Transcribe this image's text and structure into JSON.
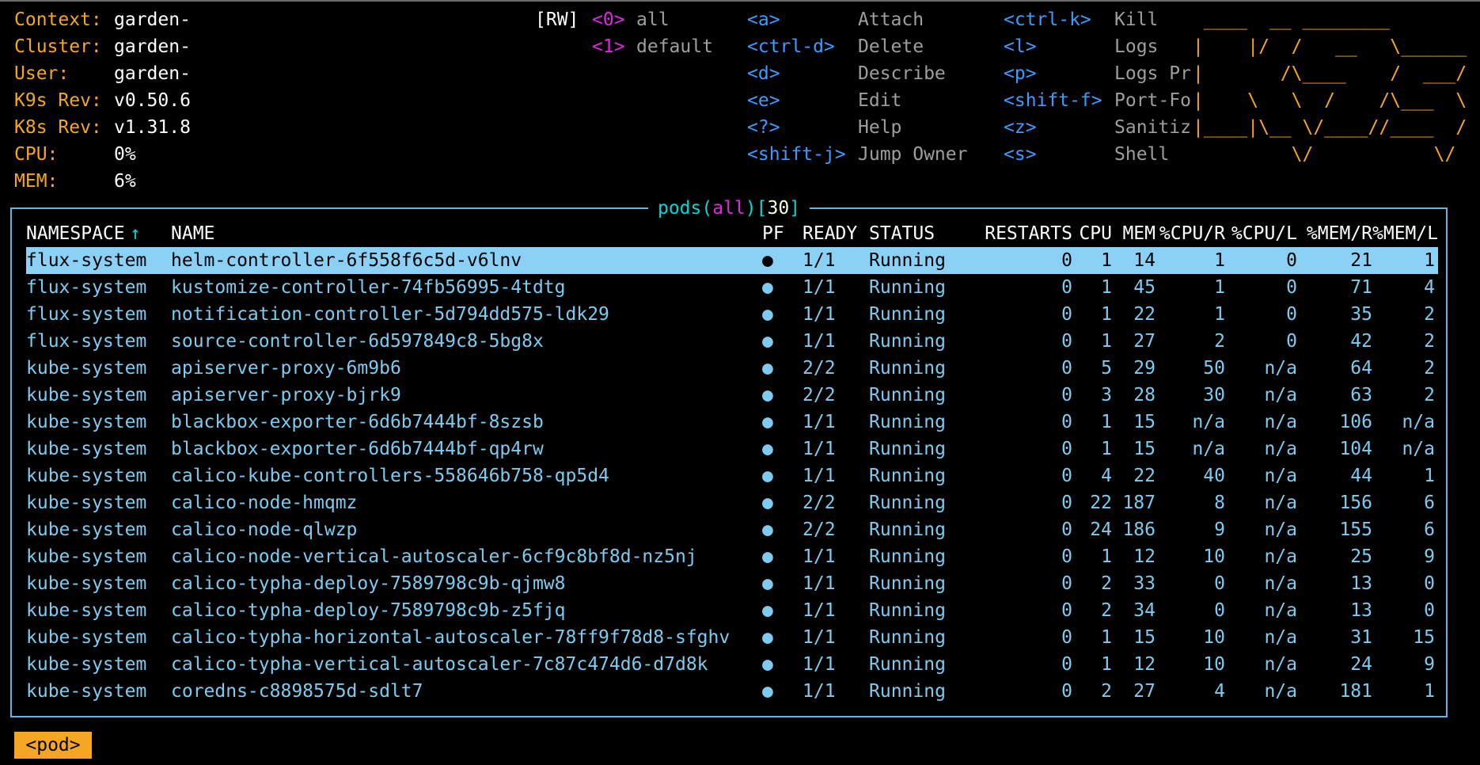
{
  "header": {
    "info": [
      {
        "label": "Context:",
        "value": "garden-"
      },
      {
        "label": "Cluster:",
        "value": "garden-"
      },
      {
        "label": "User:",
        "value": "garden-"
      },
      {
        "label": "K9s Rev:",
        "value": "v0.50.6"
      },
      {
        "label": "K8s Rev:",
        "value": "v1.31.8"
      },
      {
        "label": "CPU:",
        "value": "0%"
      },
      {
        "label": "MEM:",
        "value": "6%"
      }
    ],
    "mode": "[RW]",
    "namespaces": [
      {
        "key": "<0>",
        "name": "all"
      },
      {
        "key": "<1>",
        "name": "default"
      }
    ],
    "shortcuts_col1": [
      {
        "key": "<a>",
        "desc": "Attach"
      },
      {
        "key": "<ctrl-d>",
        "desc": "Delete"
      },
      {
        "key": "<d>",
        "desc": "Describe"
      },
      {
        "key": "<e>",
        "desc": "Edit"
      },
      {
        "key": "<?>",
        "desc": "Help"
      },
      {
        "key": "<shift-j>",
        "desc": "Jump Owner"
      }
    ],
    "shortcuts_col2": [
      {
        "key": "<ctrl-k>",
        "desc": "Kill"
      },
      {
        "key": "<l>",
        "desc": "Logs"
      },
      {
        "key": "<p>",
        "desc": "Logs Pr"
      },
      {
        "key": "<shift-f>",
        "desc": "Port-Fo"
      },
      {
        "key": "<z>",
        "desc": "Sanitiz"
      },
      {
        "key": "<s>",
        "desc": "Shell"
      }
    ],
    "logo_lines": [
      " ____  __ ________        ",
      "|    |/  /   __   \\______ ",
      "|       /\\____    /  ___/ ",
      "|    \\   \\  /    /\\___  \\ ",
      "|____|\\__ \\/____//____  / ",
      "         \\/           \\/  "
    ]
  },
  "table": {
    "title_prefix": "pods(",
    "title_ns": "all",
    "title_mid": ")[",
    "title_count": "30",
    "title_suffix": "]",
    "sort_arrow": "↑",
    "columns": [
      "NAMESPACE",
      "NAME",
      "PF",
      "READY",
      "STATUS",
      "RESTARTS",
      "CPU",
      "MEM",
      "%CPU/R",
      "%CPU/L",
      "%MEM/R",
      "%MEM/L"
    ],
    "rows": [
      [
        "flux-system",
        "helm-controller-6f558f6c5d-v6lnv",
        "●",
        "1/1",
        "Running",
        "0",
        "1",
        "14",
        "1",
        "0",
        "21",
        "1"
      ],
      [
        "flux-system",
        "kustomize-controller-74fb56995-4tdtg",
        "●",
        "1/1",
        "Running",
        "0",
        "1",
        "45",
        "1",
        "0",
        "71",
        "4"
      ],
      [
        "flux-system",
        "notification-controller-5d794dd575-ldk29",
        "●",
        "1/1",
        "Running",
        "0",
        "1",
        "22",
        "1",
        "0",
        "35",
        "2"
      ],
      [
        "flux-system",
        "source-controller-6d597849c8-5bg8x",
        "●",
        "1/1",
        "Running",
        "0",
        "1",
        "27",
        "2",
        "0",
        "42",
        "2"
      ],
      [
        "kube-system",
        "apiserver-proxy-6m9b6",
        "●",
        "2/2",
        "Running",
        "0",
        "5",
        "29",
        "50",
        "n/a",
        "64",
        "2"
      ],
      [
        "kube-system",
        "apiserver-proxy-bjrk9",
        "●",
        "2/2",
        "Running",
        "0",
        "3",
        "28",
        "30",
        "n/a",
        "63",
        "2"
      ],
      [
        "kube-system",
        "blackbox-exporter-6d6b7444bf-8szsb",
        "●",
        "1/1",
        "Running",
        "0",
        "1",
        "15",
        "n/a",
        "n/a",
        "106",
        "n/a"
      ],
      [
        "kube-system",
        "blackbox-exporter-6d6b7444bf-qp4rw",
        "●",
        "1/1",
        "Running",
        "0",
        "1",
        "15",
        "n/a",
        "n/a",
        "104",
        "n/a"
      ],
      [
        "kube-system",
        "calico-kube-controllers-558646b758-qp5d4",
        "●",
        "1/1",
        "Running",
        "0",
        "4",
        "22",
        "40",
        "n/a",
        "44",
        "1"
      ],
      [
        "kube-system",
        "calico-node-hmqmz",
        "●",
        "2/2",
        "Running",
        "0",
        "22",
        "187",
        "8",
        "n/a",
        "156",
        "6"
      ],
      [
        "kube-system",
        "calico-node-qlwzp",
        "●",
        "2/2",
        "Running",
        "0",
        "24",
        "186",
        "9",
        "n/a",
        "155",
        "6"
      ],
      [
        "kube-system",
        "calico-node-vertical-autoscaler-6cf9c8bf8d-nz5nj",
        "●",
        "1/1",
        "Running",
        "0",
        "1",
        "12",
        "10",
        "n/a",
        "25",
        "9"
      ],
      [
        "kube-system",
        "calico-typha-deploy-7589798c9b-qjmw8",
        "●",
        "1/1",
        "Running",
        "0",
        "2",
        "33",
        "0",
        "n/a",
        "13",
        "0"
      ],
      [
        "kube-system",
        "calico-typha-deploy-7589798c9b-z5fjq",
        "●",
        "1/1",
        "Running",
        "0",
        "2",
        "34",
        "0",
        "n/a",
        "13",
        "0"
      ],
      [
        "kube-system",
        "calico-typha-horizontal-autoscaler-78ff9f78d8-sfghv",
        "●",
        "1/1",
        "Running",
        "0",
        "1",
        "15",
        "10",
        "n/a",
        "31",
        "15"
      ],
      [
        "kube-system",
        "calico-typha-vertical-autoscaler-7c87c474d6-d7d8k",
        "●",
        "1/1",
        "Running",
        "0",
        "1",
        "12",
        "10",
        "n/a",
        "24",
        "9"
      ],
      [
        "kube-system",
        "coredns-c8898575d-sdlt7",
        "●",
        "1/1",
        "Running",
        "0",
        "2",
        "27",
        "4",
        "n/a",
        "181",
        "1"
      ]
    ],
    "selected_row": 0
  },
  "footer": {
    "crumb": "<pod>"
  },
  "colors": {
    "accent": "#f5a623",
    "key": "#3d9bff",
    "row_text": "#7ecbf0",
    "selected_bg": "#8bd0f5",
    "frame": "#5bb8e8",
    "title": "#00d7d7",
    "ns_key": "#e026e0"
  }
}
